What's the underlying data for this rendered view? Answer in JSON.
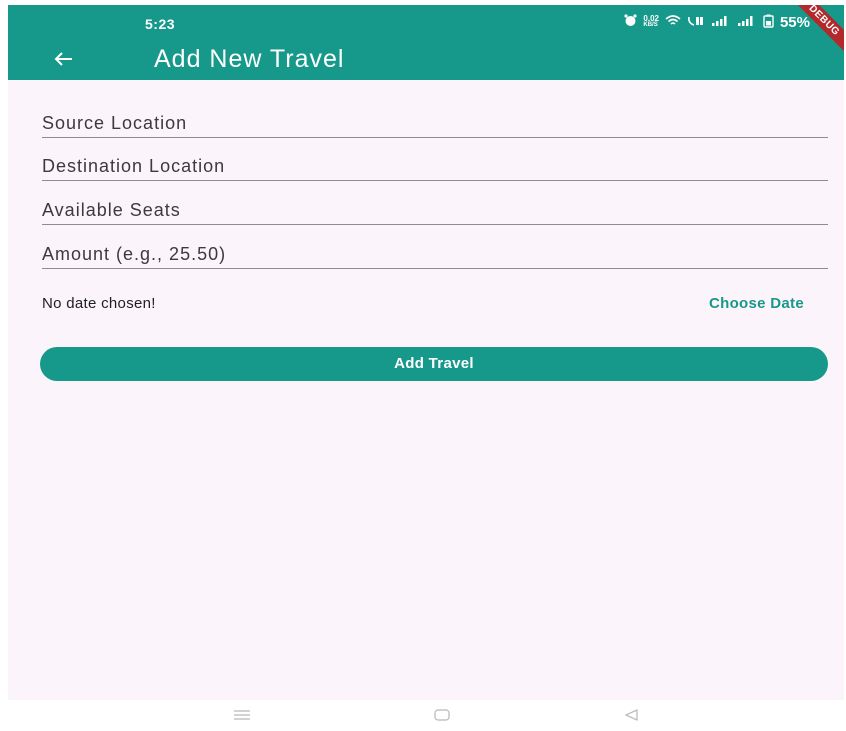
{
  "status_bar": {
    "time": "5:23",
    "network_speed": "0.02",
    "network_unit": "KB/S",
    "battery": "55%",
    "icons": [
      "alarm-icon",
      "wifi-icon",
      "volte-icon",
      "signal-icon",
      "signal-icon",
      "battery-icon"
    ]
  },
  "debug_banner": "DEBUG",
  "app_bar": {
    "back_icon": "arrow-left-icon",
    "title": "Add New Travel"
  },
  "form": {
    "source_label": "Source Location",
    "destination_label": "Destination Location",
    "seats_label": "Available Seats",
    "amount_label": "Amount (e.g., 25.50)"
  },
  "date_row": {
    "status": "No date chosen!",
    "choose_label": "Choose Date"
  },
  "submit": {
    "label": "Add Travel"
  },
  "nav_bar": {
    "items": [
      "menu-icon",
      "home-icon",
      "back-icon"
    ]
  },
  "colors": {
    "primary": "#16998a",
    "background": "#fcf4fb",
    "divider": "#8e8a92",
    "debug": "#b3282b"
  }
}
